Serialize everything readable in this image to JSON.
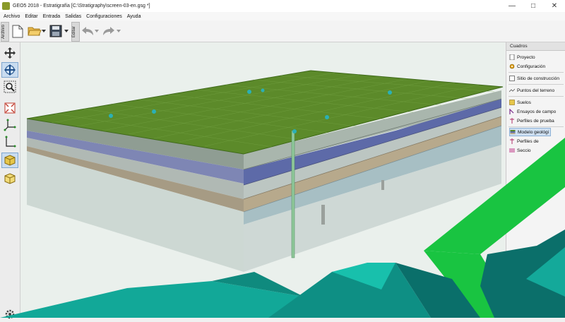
{
  "window": {
    "title": "GEO5 2018 - Estratigrafía [C:\\Stratigraphy\\screen-03-en.gsg *]",
    "minimize_icon": "minimize-icon",
    "maximize_icon": "maximize-icon",
    "close_icon": "close-icon"
  },
  "menu": {
    "items": [
      "Archivo",
      "Editar",
      "Entrada",
      "Salidas",
      "Configuraciones",
      "Ayuda"
    ]
  },
  "toolbar": {
    "tab_archivo": "Archivo",
    "tab_editar": "Editar",
    "icons": [
      "new-file-icon",
      "open-folder-icon",
      "save-icon",
      "undo-icon",
      "redo-icon"
    ]
  },
  "left_tools": {
    "icons": [
      "move-icon",
      "rotate-icon",
      "zoom-icon",
      "zoom-extents-icon",
      "axes-icon",
      "axes-2d-icon",
      "3d-view-icon",
      "3d-view-alt-icon",
      "settings-icon"
    ],
    "active_indices": [
      1,
      6
    ]
  },
  "panel": {
    "header": "Cuadros",
    "items": [
      {
        "label": "Proyecto",
        "icon": "project-icon"
      },
      {
        "label": "Configuración",
        "icon": "gear-icon"
      },
      {
        "label": "Sitio de construcción",
        "icon": "site-icon"
      },
      {
        "label": "Puntos del terreno",
        "icon": "terrain-points-icon"
      },
      {
        "label": "Suelos",
        "icon": "soils-icon"
      },
      {
        "label": "Ensayos de campo",
        "icon": "field-tests-icon"
      },
      {
        "label": "Perfiles de prueba",
        "icon": "test-profiles-icon"
      },
      {
        "label": "Modelo geológi",
        "icon": "geological-model-icon"
      },
      {
        "label": "Perfiles de",
        "icon": "profiles-icon"
      },
      {
        "label": "Seccio",
        "icon": "sections-icon"
      }
    ],
    "selected_index": 7
  },
  "colors": {
    "terrain_green": "#5c8a2a",
    "accent_green": "#19c441",
    "overlay_teal": "#12a898",
    "overlay_dark_teal": "#0b6f6a"
  }
}
